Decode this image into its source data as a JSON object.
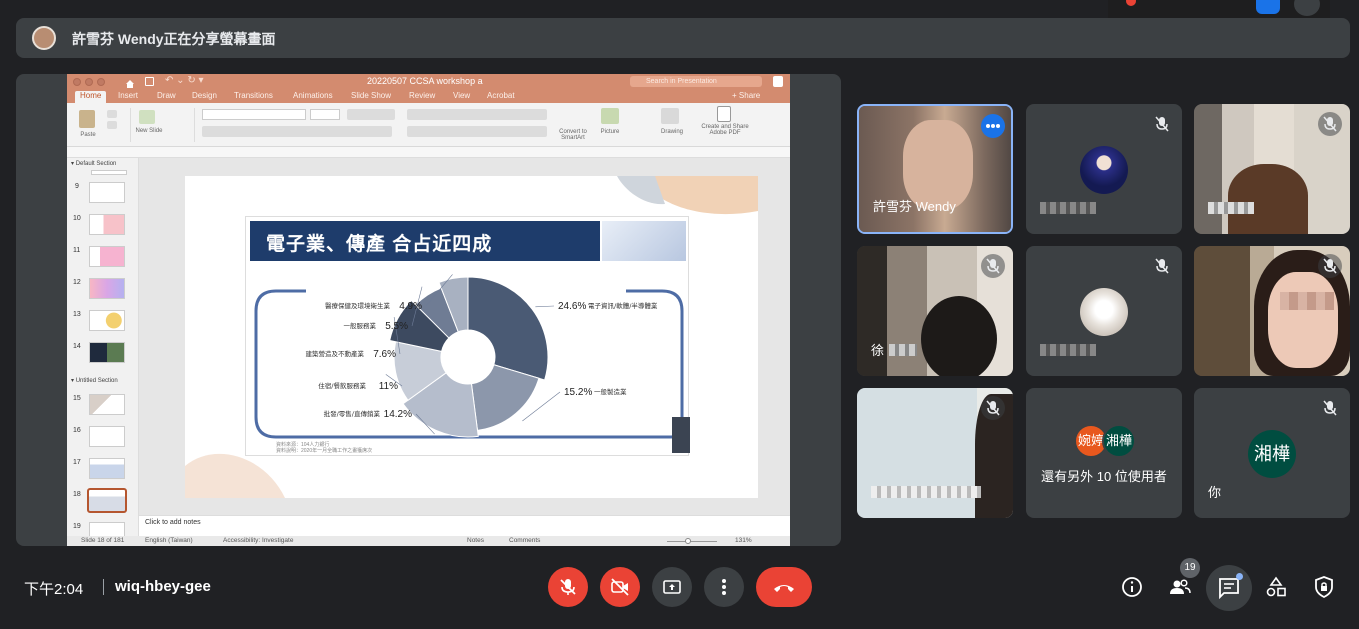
{
  "banner": {
    "text": "許雪芬 Wendy正在分享螢幕畫面"
  },
  "powerpoint": {
    "title": "20220507 CCSA workshop a",
    "search_placeholder": "Search in Presentation",
    "share_label": "Share",
    "tabs": [
      "Home",
      "Insert",
      "Draw",
      "Design",
      "Transitions",
      "Animations",
      "Slide Show",
      "Review",
      "View",
      "Acrobat"
    ],
    "ribbon": {
      "paste": "Paste",
      "new_slide": "New Slide",
      "convert": "Convert to SmartArt",
      "picture": "Picture",
      "drawing": "Drawing",
      "create_share": "Create and Share Adobe PDF"
    },
    "sections": [
      "Default Section",
      "Untitled Section"
    ],
    "thumb_numbers": [
      "9",
      "10",
      "11",
      "12",
      "13",
      "14",
      "15",
      "16",
      "17",
      "18",
      "19"
    ],
    "notes_placeholder": "Click to add notes",
    "status": {
      "slide": "Slide 18 of 181",
      "language": "English (Taiwan)",
      "accessibility": "Accessibility: Investigate",
      "notes": "Notes",
      "comments": "Comments",
      "zoom": "131%"
    }
  },
  "slide": {
    "title": "電子業、傳產 合占近四成",
    "source_line1": "資料來源：104人力銀行",
    "source_line2": "資料說明：2020年一月全職工作之畫獲席次",
    "chart_data": {
      "type": "pie",
      "style": "donut",
      "categories": [
        "電子資訊/軟體/半導體業",
        "一般製造業",
        "批發/零售/直傳銷業",
        "住宿/餐飲服務業",
        "建築營造及不動產業",
        "一般服務業",
        "醫療保健及環境衛生業"
      ],
      "values": [
        24.6,
        15.2,
        14.2,
        11,
        7.6,
        5.5,
        4.9
      ],
      "labels": [
        "24.6%",
        "15.2%",
        "14.2%",
        "11%",
        "7.6%",
        "5.5%",
        "4.9%"
      ],
      "colors": [
        "#4a5a74",
        "#8c97ab",
        "#b5bdcc",
        "#c7cdd8",
        "#3d4a60",
        "#6f7c94",
        "#a8b1c1"
      ]
    }
  },
  "participants": [
    {
      "name": "許雪芬 Wendy",
      "type": "video",
      "muted": false,
      "active": true
    },
    {
      "name": "",
      "type": "avatar",
      "muted": true
    },
    {
      "name": "",
      "type": "video",
      "muted": true
    },
    {
      "name": "徐",
      "type": "video",
      "muted": true
    },
    {
      "name": "",
      "type": "avatar",
      "muted": true
    },
    {
      "name": "",
      "type": "video",
      "muted": true
    },
    {
      "name": "",
      "type": "video",
      "muted": true
    },
    {
      "name": "還有另外 10 位使用者",
      "type": "others",
      "initials": [
        "婉婷",
        "湘樺"
      ]
    },
    {
      "name": "你",
      "type": "self",
      "initial": "湘樺",
      "muted": true
    }
  ],
  "controls": {
    "time": "下午2:04",
    "meeting_code": "wiq-hbey-gee",
    "people_count": "19"
  },
  "colors": {
    "accent": "#1a73e8",
    "danger": "#ea4335",
    "tile_bg": "#3c4043",
    "page_bg": "#202124",
    "ppt_brand": "#d38b6f"
  },
  "icons": [
    "mic-off-icon",
    "camera-off-icon",
    "present-icon",
    "more-icon",
    "hangup-icon",
    "info-icon",
    "people-icon",
    "chat-icon",
    "activities-icon",
    "host-controls-icon"
  ]
}
